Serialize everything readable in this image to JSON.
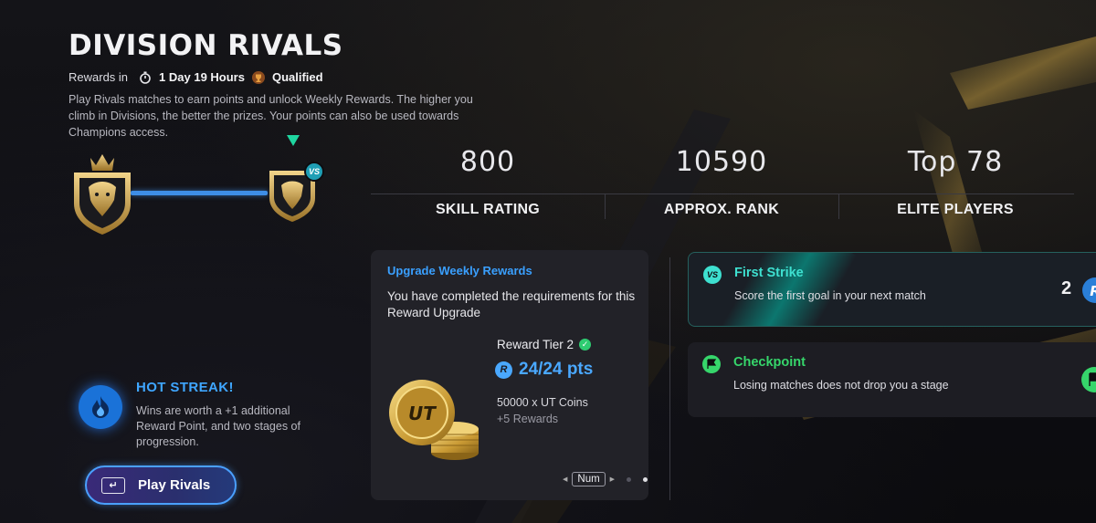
{
  "header": {
    "title": "DIVISION RIVALS",
    "rewards_label": "Rewards in",
    "timer": "1 Day 19 Hours",
    "status": "Qualified",
    "description": "Play Rivals matches to earn points and unlock Weekly Rewards. The higher you climb in Divisions, the better the prizes. Your points can also be used towards Champions access."
  },
  "progression": {
    "current_marker": "VS"
  },
  "stats": [
    {
      "value": "800",
      "label": "SKILL RATING"
    },
    {
      "value": "10590",
      "label": "APPROX. RANK"
    },
    {
      "value": "Top 78",
      "label": "ELITE PLAYERS"
    }
  ],
  "upgrade_card": {
    "heading": "Upgrade Weekly Rewards",
    "message": "You have completed the requirements for this Reward Upgrade",
    "tier": "Reward Tier 2",
    "points": "24/24 pts",
    "coins": "50000 x UT Coins",
    "extra": "+5 Rewards",
    "coin_text": "UT",
    "pager_key": "Num"
  },
  "objectives": [
    {
      "icon": "vs-icon",
      "title": "First Strike",
      "description": "Score the first goal in your next match",
      "count": "2",
      "title_color": "#3ee0d0"
    },
    {
      "icon": "flag-icon",
      "title": "Checkpoint",
      "description": "Losing matches does not drop you a stage",
      "count": "",
      "title_color": "#36d66b"
    }
  ],
  "hot_streak": {
    "title": "HOT STREAK!",
    "description": "Wins are worth a +1 additional Reward Point, and two stages of progression."
  },
  "play_button": {
    "label": "Play Rivals"
  },
  "colors": {
    "accent_blue": "#3aa0ff",
    "teal": "#3ee0d0",
    "green": "#36d66b",
    "gold": "#c9a043"
  }
}
